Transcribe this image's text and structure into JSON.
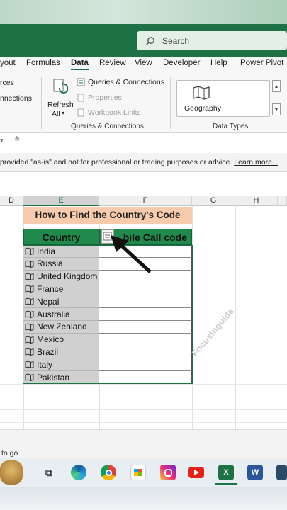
{
  "search": {
    "placeholder": "Search"
  },
  "menu": {
    "items": [
      "yout",
      "Formulas",
      "Data",
      "Review",
      "View",
      "Developer",
      "Help",
      "Power Pivot"
    ],
    "active": "Data"
  },
  "ribbon": {
    "left_fragments": [
      "rces",
      "nnections"
    ],
    "refresh_all": [
      "Refresh",
      "All"
    ],
    "queries_connections": "Queries & Connections",
    "properties": "Properties",
    "workbook_links": "Workbook Links",
    "group_queries": "Queries & Connections",
    "geography": "Geography",
    "group_data_types": "Data Types"
  },
  "notice": {
    "text": "provided \"as-is\" and not for professional or trading purposes or advice.",
    "link": "Learn more..."
  },
  "columns": [
    "D",
    "E",
    "F",
    "G",
    "H"
  ],
  "sheet": {
    "heading": "How to Find the Country's Code",
    "header_country": "Country",
    "header_code": "bile Call code",
    "countries": [
      "India",
      "Russia",
      "United Kingdom",
      "France",
      "Nepal",
      "Australia",
      "New Zealand",
      "Mexico",
      "Brazil",
      "Italy",
      "Pakistan"
    ]
  },
  "watermark": "Focusinguide",
  "status": {
    "text": "to go"
  },
  "colors": {
    "excel_green": "#1e7145",
    "heading_fill": "#f8cbad",
    "header_fill": "#1f8a4c"
  },
  "taskbar_icons": [
    "avatar-icon",
    "task-view-icon",
    "edge-icon",
    "chrome-icon",
    "store-icon",
    "instagram-icon",
    "youtube-icon",
    "excel-icon",
    "word-icon",
    "app-icon"
  ]
}
